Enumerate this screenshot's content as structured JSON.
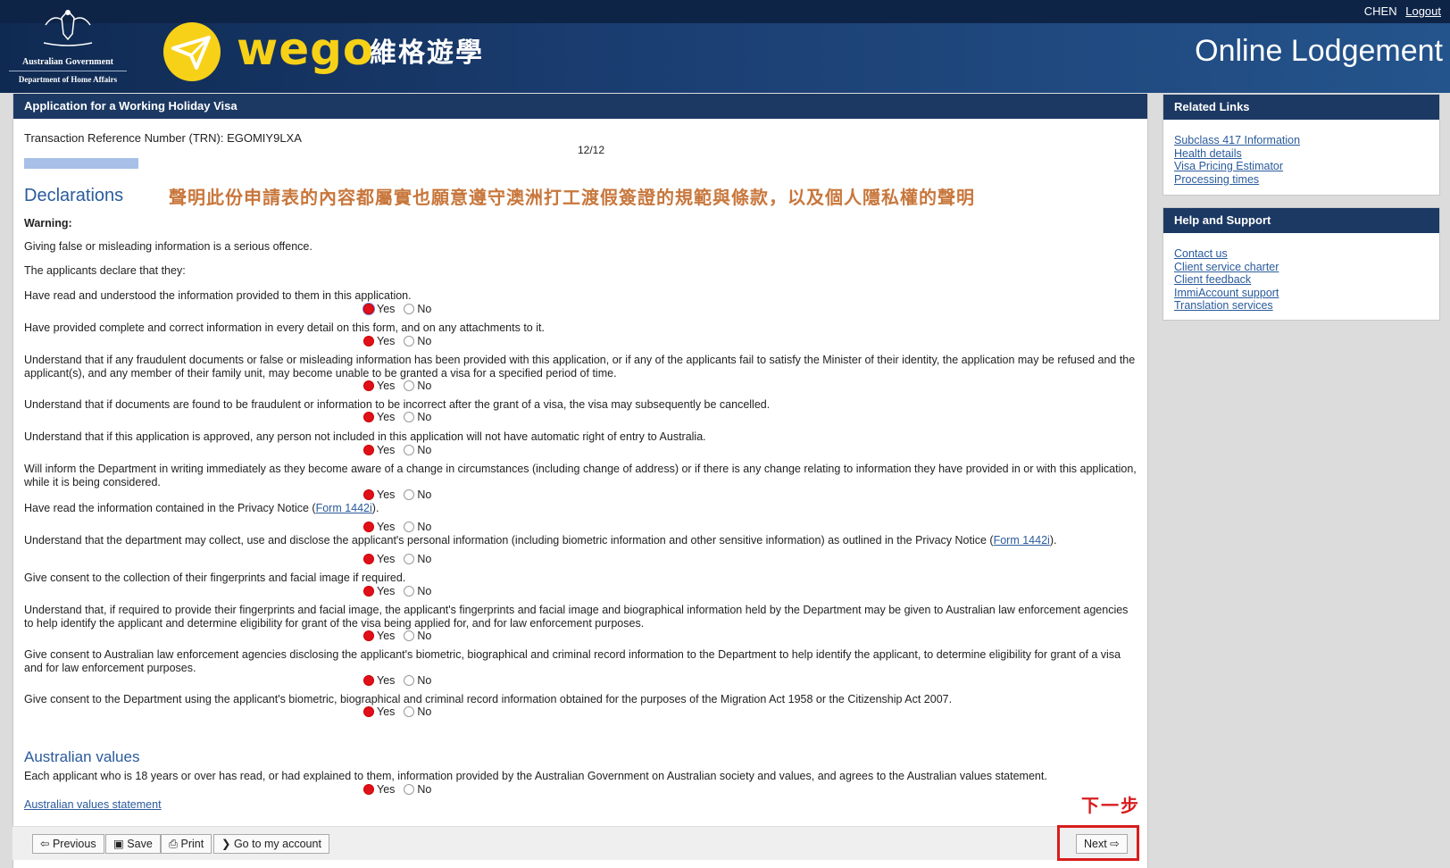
{
  "header": {
    "gov_line1": "Australian Government",
    "gov_line2": "Department of Home Affairs",
    "brand": "wego",
    "brand_cn": "維格遊學",
    "user": "CHEN",
    "logout": "Logout",
    "title": "Online Lodgement",
    "brand_color": "#f7d117"
  },
  "main": {
    "panel_title": "Application for a Working Holiday Visa",
    "trn": "Transaction Reference Number (TRN): EGOMIY9LXA",
    "page": "12/12",
    "declarations_heading": "Declarations",
    "cn_note": "聲明此份申請表的內容都屬實也願意遵守澳洲打工渡假簽證的規範與條款，以及個人隱私權的聲明",
    "warning": "Warning:",
    "p1": "Giving false or misleading information is a serious offence.",
    "p2": "The applicants declare that they:",
    "yes_label": "Yes",
    "no_label": "No",
    "questions": [
      {
        "text": "Have read and understood the information provided to them in this application.",
        "answer": "Yes"
      },
      {
        "text": "Have provided complete and correct information in every detail on this form, and on any attachments to it.",
        "answer": "Yes"
      },
      {
        "text": "Understand that if any fraudulent documents or false or misleading information has been provided with this application, or if any of the applicants fail to satisfy the Minister of their identity, the application may be refused and the applicant(s), and any member of their family unit, may become unable to be granted a visa for a specified period of time.",
        "answer": "Yes"
      },
      {
        "text": "Understand that if documents are found to be fraudulent or information to be incorrect after the grant of a visa, the visa may subsequently be cancelled.",
        "answer": "Yes"
      },
      {
        "text": "Understand that if this application is approved, any person not included in this application will not have automatic right of entry to Australia.",
        "answer": "Yes"
      },
      {
        "text": "Will inform the Department in writing immediately as they become aware of a change in circumstances (including change of address) or if there is any change relating to information they have provided in or with this application, while it is being considered.",
        "answer": "Yes"
      },
      {
        "text_before": "Have read the information contained in the Privacy Notice (",
        "link": "Form 1442i",
        "text_after": ").",
        "answer": "Yes"
      },
      {
        "text_before": "Understand that the department may collect, use and disclose the applicant's personal information (including biometric information and other sensitive information) as outlined in the Privacy Notice (",
        "link": "Form 1442i",
        "text_after": ").",
        "answer": "Yes"
      },
      {
        "text": "Give consent to the collection of their fingerprints and facial image if required.",
        "answer": "Yes"
      },
      {
        "text": "Understand that, if required to provide their fingerprints and facial image, the applicant's fingerprints and facial image and biographical information held by the Department may be given to Australian law enforcement agencies to help identify the applicant and determine eligibility for grant of the visa being applied for, and for law enforcement purposes.",
        "answer": "Yes"
      },
      {
        "text": "Give consent to Australian law enforcement agencies disclosing the applicant's biometric, biographical and criminal record information to the Department to help identify the applicant, to determine eligibility for grant of a visa and for law enforcement purposes.",
        "answer": "Yes"
      },
      {
        "text": "Give consent to the Department using the applicant's biometric, biographical and criminal record information obtained for the purposes of the Migration Act 1958 or the Citizenship Act 2007.",
        "answer": "Yes"
      }
    ],
    "values_heading": "Australian values",
    "values_question": {
      "text": "Each applicant who is 18 years or over has read, or had explained to them, information provided by the Australian Government on Australian society and values, and agrees to the Australian values statement.",
      "answer": "Yes"
    },
    "values_link": "Australian values statement",
    "cn_next": "下一步"
  },
  "buttons": {
    "previous": "Previous",
    "save": "Save",
    "print": "Print",
    "account": "Go to my account",
    "next": "Next"
  },
  "related_links": {
    "title": "Related Links",
    "items": [
      "Subclass 417 Information",
      "Health details",
      "Visa Pricing Estimator",
      "Processing times"
    ]
  },
  "help_support": {
    "title": "Help and Support",
    "items": [
      "Contact us",
      "Client service charter",
      "Client feedback",
      "ImmiAccount support",
      "Translation services"
    ]
  }
}
